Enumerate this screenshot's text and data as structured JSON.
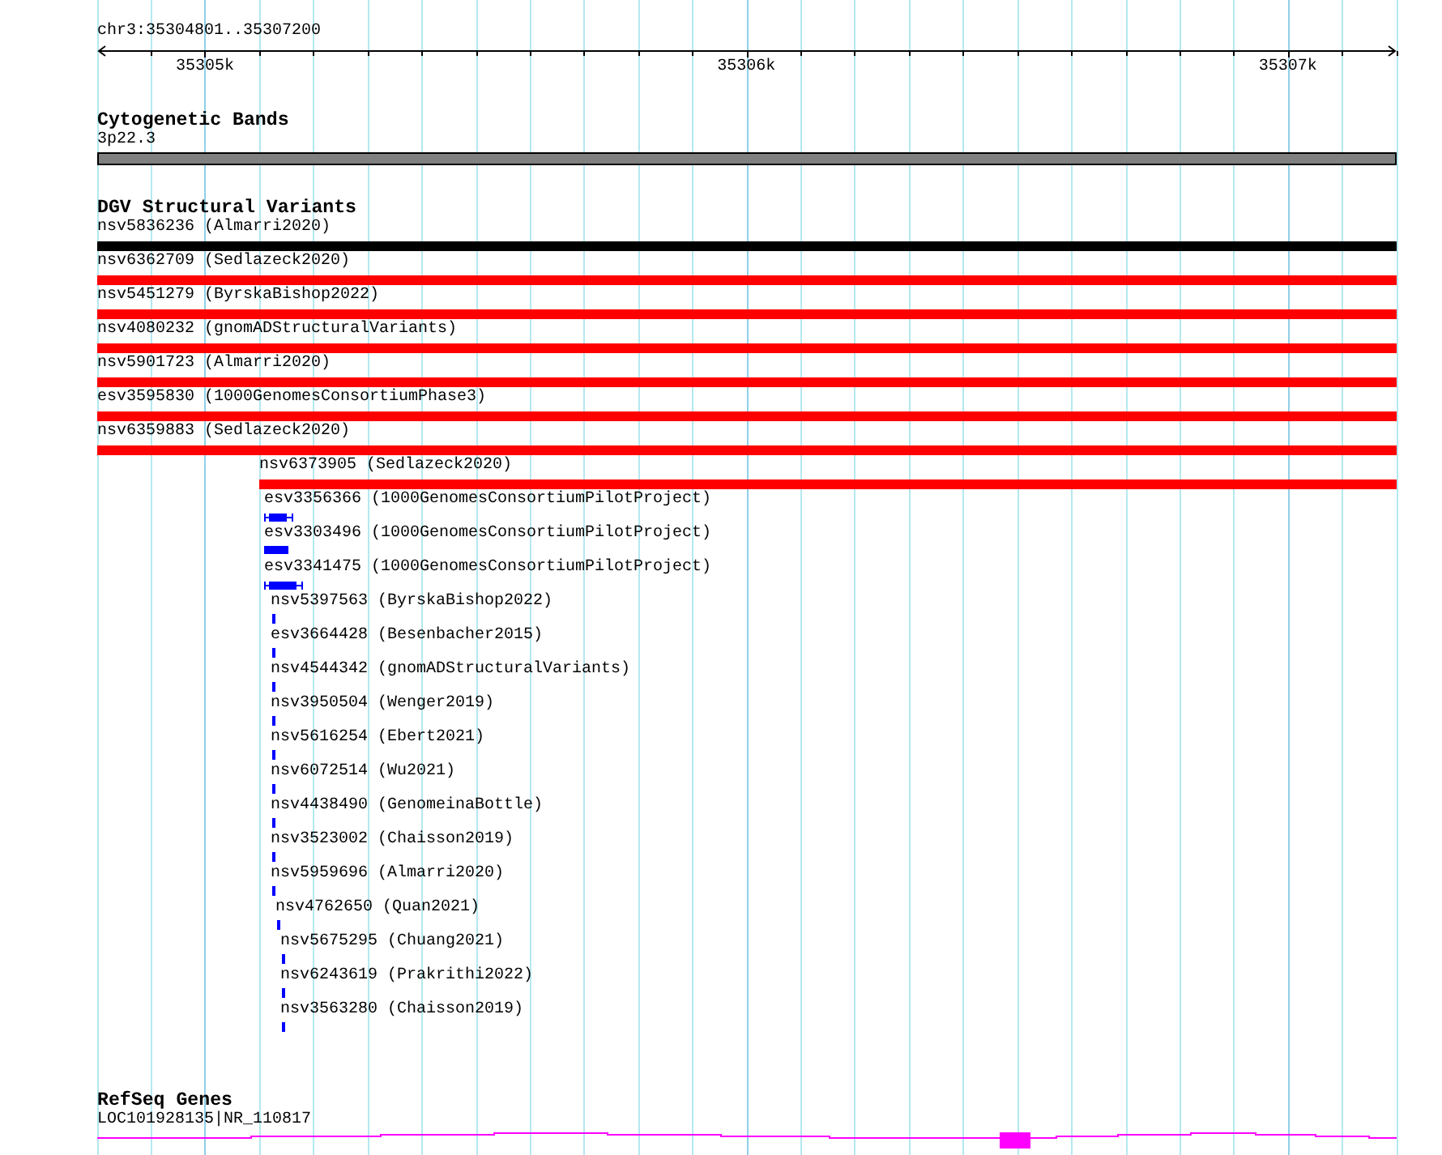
{
  "ruler": {
    "range": "chr3:35304801..35307200",
    "tick_labels": [
      "35305k",
      "35306k",
      "35307k"
    ]
  },
  "cytogenetic_bands": {
    "title": "Cytogenetic Bands",
    "features": [
      {
        "label": "3p22.3",
        "kind": "band"
      }
    ]
  },
  "dgv_structural_variants": {
    "title": "DGV Structural Variants",
    "features": [
      {
        "label": "nsv5836236 (Almarri2020)",
        "kind": "bar",
        "color": "#000000"
      },
      {
        "label": "nsv6362709 (Sedlazeck2020)",
        "kind": "bar",
        "color": "#ff0000"
      },
      {
        "label": "nsv5451279 (ByrskaBishop2022)",
        "kind": "bar",
        "color": "#ff0000"
      },
      {
        "label": "nsv4080232 (gnomADStructuralVariants)",
        "kind": "bar",
        "color": "#ff0000"
      },
      {
        "label": "nsv5901723 (Almarri2020)",
        "kind": "bar",
        "color": "#ff0000"
      },
      {
        "label": "esv3595830 (1000GenomesConsortiumPhase3)",
        "kind": "bar",
        "color": "#ff0000"
      },
      {
        "label": "nsv6359883 (Sedlazeck2020)",
        "kind": "bar",
        "color": "#ff0000"
      },
      {
        "label": "nsv6373905 (Sedlazeck2020)",
        "kind": "bar",
        "color": "#ff0000"
      },
      {
        "label": "esv3356366 (1000GenomesConsortiumPilotProject)",
        "kind": "whisker",
        "color": "#0000ff"
      },
      {
        "label": "esv3303496 (1000GenomesConsortiumPilotProject)",
        "kind": "bar",
        "color": "#0000ff"
      },
      {
        "label": "esv3341475 (1000GenomesConsortiumPilotProject)",
        "kind": "whisker",
        "color": "#0000ff"
      },
      {
        "label": "nsv5397563 (ByrskaBishop2022)",
        "kind": "bar",
        "color": "#0000ff"
      },
      {
        "label": "esv3664428 (Besenbacher2015)",
        "kind": "bar",
        "color": "#0000ff"
      },
      {
        "label": "nsv4544342 (gnomADStructuralVariants)",
        "kind": "bar",
        "color": "#0000ff"
      },
      {
        "label": "nsv3950504 (Wenger2019)",
        "kind": "bar",
        "color": "#0000ff"
      },
      {
        "label": "nsv5616254 (Ebert2021)",
        "kind": "bar",
        "color": "#0000ff"
      },
      {
        "label": "nsv6072514 (Wu2021)",
        "kind": "bar",
        "color": "#0000ff"
      },
      {
        "label": "nsv4438490 (GenomeinaBottle)",
        "kind": "bar",
        "color": "#0000ff"
      },
      {
        "label": "nsv3523002 (Chaisson2019)",
        "kind": "bar",
        "color": "#0000ff"
      },
      {
        "label": "nsv5959696 (Almarri2020)",
        "kind": "bar",
        "color": "#0000ff"
      },
      {
        "label": "nsv4762650 (Quan2021)",
        "kind": "bar",
        "color": "#0000ff"
      },
      {
        "label": "nsv5675295 (Chuang2021)",
        "kind": "bar",
        "color": "#0000ff"
      },
      {
        "label": "nsv6243619 (Prakrithi2022)",
        "kind": "bar",
        "color": "#0000ff"
      },
      {
        "label": "nsv3563280 (Chaisson2019)",
        "kind": "bar",
        "color": "#0000ff"
      }
    ]
  },
  "refseq_genes": {
    "title": "RefSeq Genes",
    "features": [
      {
        "label": "LOC101928135|NR_110817",
        "kind": "gene"
      }
    ]
  }
}
